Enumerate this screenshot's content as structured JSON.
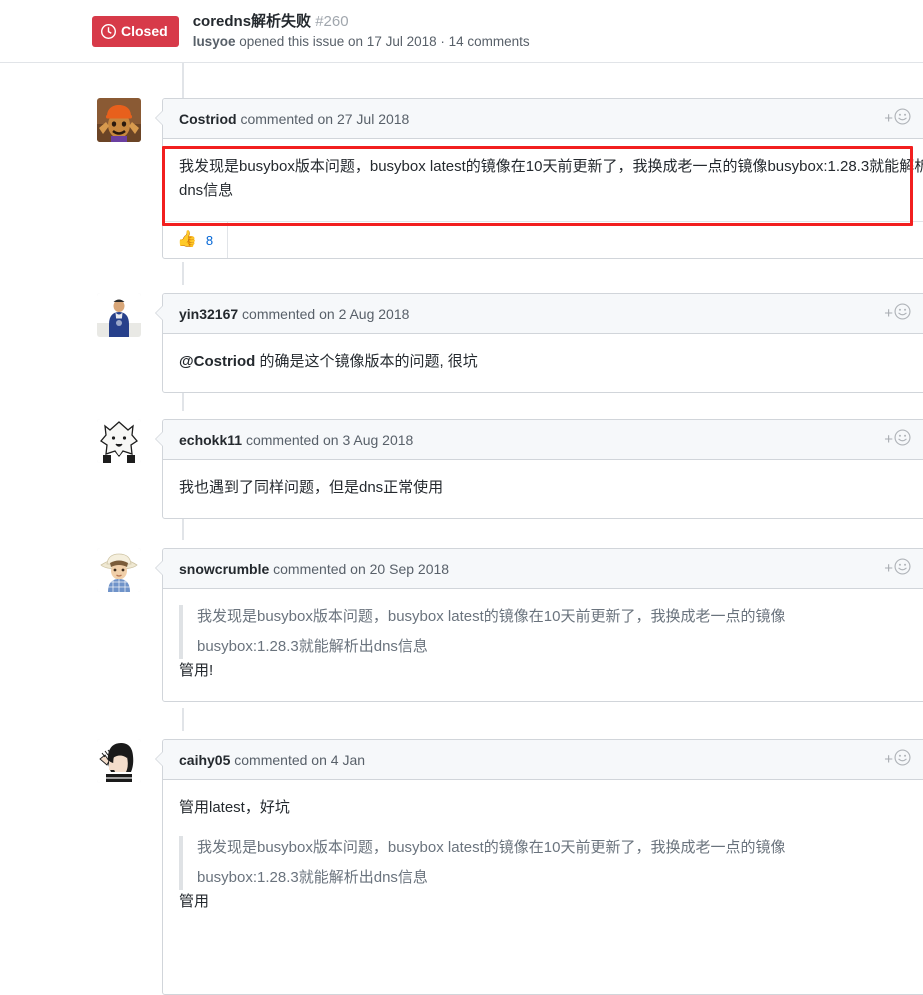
{
  "header": {
    "state_badge": {
      "label": "Closed",
      "icon": "issue-closed-icon",
      "color": "#d73a49"
    },
    "title": "coredns解析失败",
    "issue_number": "#260",
    "author": "lusyoe",
    "meta": " opened this issue on 17 Jul 2018 · 14 comments"
  },
  "actions": {
    "add_reaction": "+",
    "reaction_icon": "smiley-face-icon",
    "menu_icon": "kebab-horizontal-icon"
  },
  "comments": [
    {
      "user": "Costriod",
      "byline_verb": " commented on ",
      "date": "27 Jul 2018",
      "avatar": "costriod-avatar",
      "body_line1": "我发现是busybox版本问题，busybox latest的镜像在10天前更新了，我换成老一点的镜像busybox:1.28.3就能",
      "body_line2": "解析出dns信息",
      "reaction": {
        "emoji": "👍",
        "name": "thumbs-up-reaction",
        "count": "8"
      },
      "highlighted": true
    },
    {
      "user": "yin32167",
      "byline_verb": " commented on ",
      "date": "2 Aug 2018",
      "avatar": "yin32167-avatar",
      "mention": "@Costriod",
      "body_line1": " 的确是这个镜像版本的问题, 很坑"
    },
    {
      "user": "echokk11",
      "byline_verb": " commented on ",
      "date": "3 Aug 2018",
      "avatar": "echokk11-avatar",
      "body_line1": "我也遇到了同样问题，但是dns正常使用"
    },
    {
      "user": "snowcrumble",
      "byline_verb": " commented on ",
      "date": "20 Sep 2018",
      "avatar": "snowcrumble-avatar",
      "quote_line1": "我发现是busybox版本问题，busybox latest的镜像在10天前更新了，我换成老一点的镜像",
      "quote_line2": "busybox:1.28.3就能解析出dns信息",
      "body_line1": "管用!"
    },
    {
      "user": "caihy05",
      "byline_verb": " commented on ",
      "date": "4 Jan",
      "avatar": "caihy05-avatar",
      "body_line1": "管用latest，好坑",
      "quote_line1": "我发现是busybox版本问题，busybox latest的镜像在10天前更新了，我换成老一点的镜像",
      "quote_line2": "busybox:1.28.3就能解析出dns信息",
      "body_line2": "管用"
    }
  ],
  "annotation": {
    "name": "red-highlight-box",
    "color": "#f21f1f"
  }
}
